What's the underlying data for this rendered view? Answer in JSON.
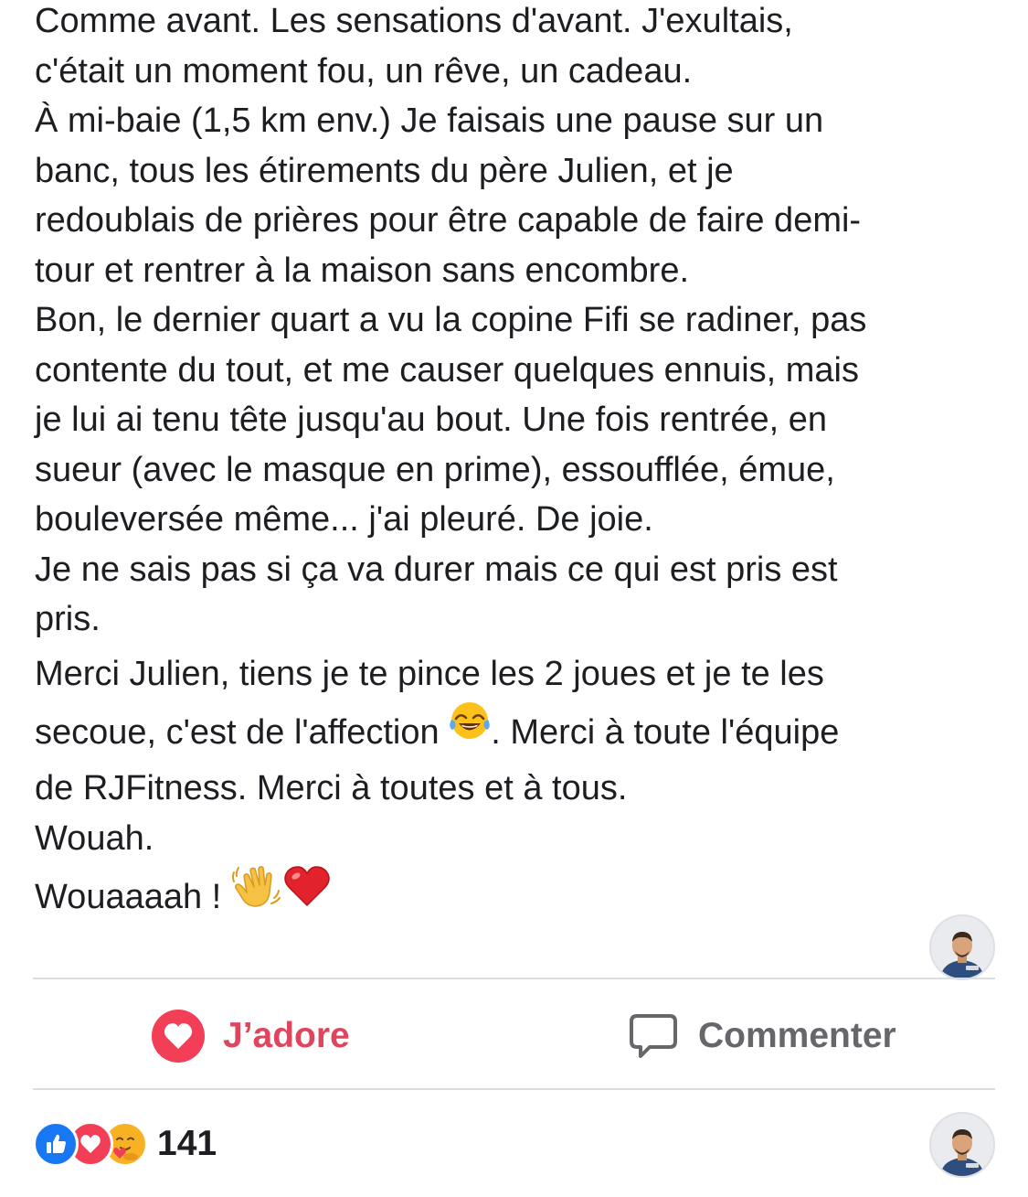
{
  "post": {
    "lines": [
      "Comme avant. Les sensations d'avant. J'exultais,",
      "c'était un moment fou, un rêve, un cadeau.",
      "À mi-baie (1,5 km env.) Je faisais une pause sur un",
      "banc, tous les étirements du père Julien, et je",
      "redoublais de prières pour être capable de faire demi-",
      "tour et rentrer à la maison sans encombre.",
      "Bon, le dernier quart a vu la copine Fifi se radiner, pas",
      "contente du tout, et me causer quelques ennuis, mais",
      "je lui ai tenu tête jusqu'au bout. Une fois rentrée, en",
      "sueur (avec le masque en prime), essoufflée, émue,",
      "bouleversée même... j'ai pleuré. De joie.",
      "Je ne sais pas si ça va durer mais ce qui est pris est",
      "pris.",
      "Merci Julien, tiens je te pince les 2 joues et je te les"
    ],
    "line_emoji_before": "secoue, c'est de l'affection ",
    "line_emoji_after": ". Merci à toute l'équipe",
    "line_after_emoji": "de RJFitness. Merci à toutes et à tous.",
    "wouah": "Wouah.",
    "wouaaaah": "Wouaaaah ! ",
    "emojis": {
      "laugh": "face-with-tears-of-joy-icon",
      "wave": "waving-hand-icon",
      "heart": "red-heart-icon"
    }
  },
  "actions": {
    "love_label": "J’adore",
    "love_color": "#e0455e",
    "comment_label": "Commenter",
    "comment_color": "#65676b"
  },
  "reactions": {
    "count": "141",
    "types": [
      "like",
      "love",
      "care"
    ],
    "colors": {
      "like": "#1877f2",
      "love": "#f33e58",
      "care": "#f7b125"
    }
  }
}
